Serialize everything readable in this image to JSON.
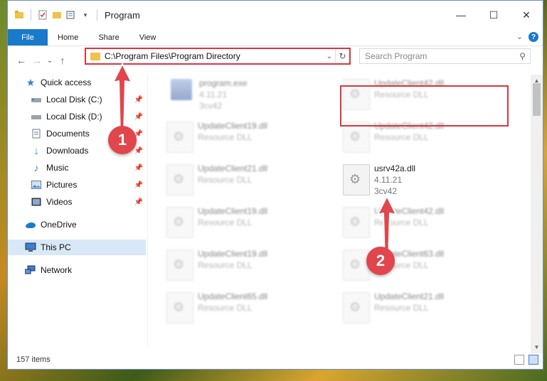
{
  "window": {
    "title": "Program",
    "controls": {
      "minimize": "—",
      "maximize": "☐",
      "close": "✕"
    }
  },
  "ribbon": {
    "tabs": [
      "File",
      "Home",
      "Share",
      "View"
    ],
    "expand": "⌄",
    "help": "?"
  },
  "nav": {
    "back": "←",
    "forward": "→",
    "recent": "⌄",
    "up": "↑",
    "address": "C:\\Program Files\\Program Directory",
    "search_placeholder": "Search Program"
  },
  "sidebar": {
    "items": [
      {
        "label": "Quick access",
        "icon": "star-icon"
      },
      {
        "label": "Local Disk (C:)",
        "icon": "drive-icon",
        "pinned": true
      },
      {
        "label": "Local Disk (D:)",
        "icon": "drive-icon",
        "pinned": true
      },
      {
        "label": "Documents",
        "icon": "documents-icon",
        "pinned": true
      },
      {
        "label": "Downloads",
        "icon": "download-icon",
        "pinned": true
      },
      {
        "label": "Music",
        "icon": "music-icon",
        "pinned": true
      },
      {
        "label": "Pictures",
        "icon": "pictures-icon",
        "pinned": true
      },
      {
        "label": "Videos",
        "icon": "videos-icon",
        "pinned": true
      },
      {
        "label": "OneDrive",
        "icon": "cloud-icon"
      },
      {
        "label": "This PC",
        "icon": "computer-icon",
        "selected": true
      },
      {
        "label": "Network",
        "icon": "network-icon"
      }
    ]
  },
  "files": [
    {
      "name": "program.exe",
      "line2": "4.11.21",
      "line3": "3cv42"
    },
    {
      "name": "UpdateClient42.dll",
      "line2": "Resource DLL"
    },
    {
      "name": "UpdateClient19.dll",
      "line2": "Resource DLL"
    },
    {
      "name": "UpdateClient42.dll",
      "line2": "Resource DLL"
    },
    {
      "name": "UpdateClient21.dll",
      "line2": "Resource DLL"
    },
    {
      "name": "usrv42a.dll",
      "line2": "4.11.21",
      "line3": "3cv42"
    },
    {
      "name": "UpdateClient19.dll",
      "line2": "Resource DLL"
    },
    {
      "name": "UpdateClient42.dll",
      "line2": "Resource DLL"
    },
    {
      "name": "UpdateClient19.dll",
      "line2": "Resource DLL"
    },
    {
      "name": "UpdateClient63.dll",
      "line2": "Resource DLL"
    },
    {
      "name": "UpdateClient65.dll",
      "line2": "Resource DLL"
    },
    {
      "name": "UpdateClient21.dll",
      "line2": "Resource DLL"
    }
  ],
  "status": {
    "items_count": "157 items"
  },
  "callouts": {
    "one": "1",
    "two": "2"
  },
  "colors": {
    "accent": "#1979ca",
    "callout": "#e0464c",
    "highlight": "#d9363e",
    "selected": "#d9e8f7"
  }
}
